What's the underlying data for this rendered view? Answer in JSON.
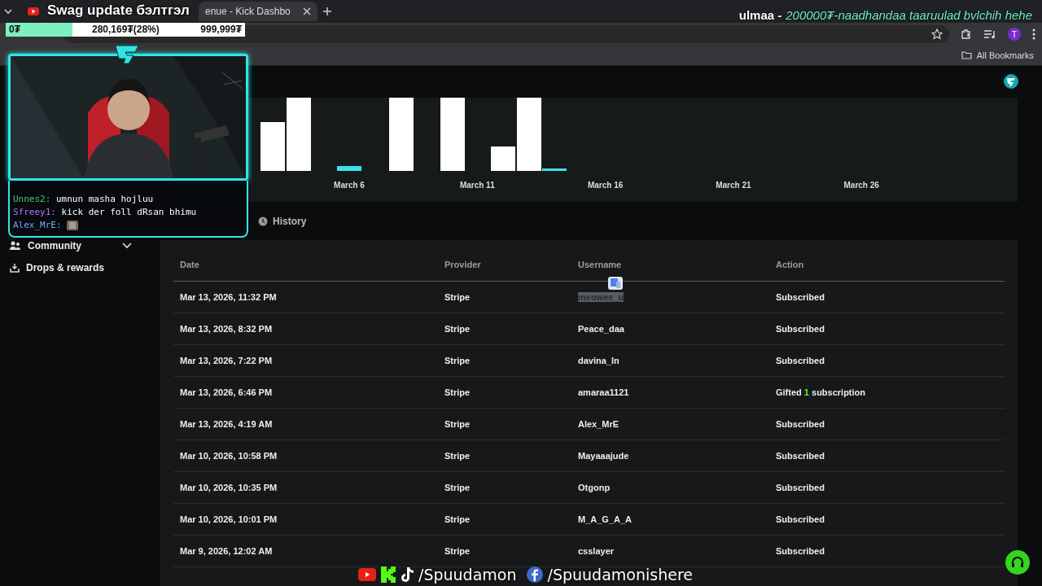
{
  "browser": {
    "tabs": [
      {
        "label": "enue - Kick Dashbo",
        "selected": true
      }
    ],
    "bookmarks": "All Bookmarks",
    "profile": "T"
  },
  "overlay": {
    "title": "Swag update бэлтгэл",
    "goal": {
      "start": "0₮",
      "current": "280,169₮(28%)",
      "target": "999,999₮",
      "level": 0.28
    },
    "donation": {
      "donor": "ulmaa -",
      "message": "200000₮-naadhandaa taaruulad bvlchih hehe"
    },
    "chat": [
      {
        "user": "Unnes2:",
        "text": "umnun masha hojluu",
        "color": "#3ecf6e"
      },
      {
        "user": "Sfreey1:",
        "text": "kick der foll dRsan bhimu",
        "color": "#b071ff"
      },
      {
        "user": "Alex_MrE:",
        "color": "#6ea6ff",
        "kind": "emote"
      }
    ],
    "socials": [
      "/Spuudamon",
      "/Spuudamonishere"
    ]
  },
  "sidebar": {
    "items": [
      {
        "label": "Community",
        "expanded": false,
        "kind": "group"
      },
      {
        "label": "Drops & rewards",
        "kind": "link"
      }
    ]
  },
  "chart": {
    "x_labels": [
      "March 6",
      "March 11",
      "March 16",
      "March 21",
      "March 26"
    ]
  },
  "history_tab": "History",
  "table": {
    "columns": [
      "Date",
      "Provider",
      "Username",
      "Action"
    ],
    "rows": [
      {
        "date": "Mar 13, 2026, 11:32 PM",
        "provider": "Stripe",
        "username": "meowee_u",
        "action": {
          "kind": "plain",
          "text": "Subscribed"
        },
        "selected": true
      },
      {
        "date": "Mar 13, 2026, 8:32 PM",
        "provider": "Stripe",
        "username": "Peace_daa",
        "action": {
          "kind": "plain",
          "text": "Subscribed"
        },
        "selected": false
      },
      {
        "date": "Mar 13, 2026, 7:22 PM",
        "provider": "Stripe",
        "username": "davina_ln",
        "action": {
          "kind": "plain",
          "text": "Subscribed"
        },
        "selected": false
      },
      {
        "date": "Mar 13, 2026, 6:46 PM",
        "provider": "Stripe",
        "username": "amaraa1121",
        "action": {
          "kind": "gift",
          "prefix": "Gifted",
          "count": "1",
          "suffix": "subscription"
        },
        "selected": false
      },
      {
        "date": "Mar 13, 2026, 4:19 AM",
        "provider": "Stripe",
        "username": "Alex_MrE",
        "action": {
          "kind": "plain",
          "text": "Subscribed"
        },
        "selected": false
      },
      {
        "date": "Mar 10, 2026, 10:58 PM",
        "provider": "Stripe",
        "username": "Mayaaajude",
        "action": {
          "kind": "plain",
          "text": "Subscribed"
        },
        "selected": false
      },
      {
        "date": "Mar 10, 2026, 10:35 PM",
        "provider": "Stripe",
        "username": "Otgonp",
        "action": {
          "kind": "plain",
          "text": "Subscribed"
        },
        "selected": false
      },
      {
        "date": "Mar 10, 2026, 10:01 PM",
        "provider": "Stripe",
        "username": "M_A_G_A_A",
        "action": {
          "kind": "plain",
          "text": "Subscribed"
        },
        "selected": false
      },
      {
        "date": "Mar 9, 2026, 12:02 AM",
        "provider": "Stripe",
        "username": "csslayer",
        "action": {
          "kind": "plain",
          "text": "Subscribed"
        },
        "selected": false
      }
    ]
  }
}
